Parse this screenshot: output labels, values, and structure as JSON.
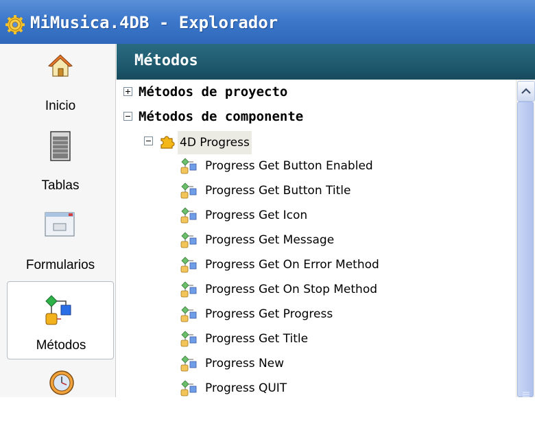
{
  "window": {
    "title": "MiMusica.4DB - Explorador"
  },
  "sidebar": {
    "items": [
      {
        "label": "Inicio",
        "icon": "home-icon"
      },
      {
        "label": "Tablas",
        "icon": "tables-icon"
      },
      {
        "label": "Formularios",
        "icon": "forms-icon"
      },
      {
        "label": "Métodos",
        "icon": "methods-icon",
        "active": true
      },
      {
        "label": "",
        "icon": "clock-icon"
      }
    ]
  },
  "panel": {
    "header": "Métodos"
  },
  "tree": {
    "groups": [
      {
        "label": "Métodos de proyecto",
        "expanded": false
      },
      {
        "label": "Métodos de componente",
        "expanded": true
      }
    ],
    "component": {
      "label": "4D Progress",
      "expanded": true
    },
    "methods": [
      "Progress Get Button Enabled",
      "Progress Get Button Title",
      "Progress Get Icon",
      "Progress Get Message",
      "Progress Get On Error Method",
      "Progress Get On Stop Method",
      "Progress Get Progress",
      "Progress Get Title",
      "Progress New",
      "Progress QUIT"
    ]
  },
  "colors": {
    "titlebar": "#3d78cb",
    "header": "#1f5b70",
    "selection": "#ecebe3",
    "scrollbar_thumb": "#bcccf2"
  }
}
